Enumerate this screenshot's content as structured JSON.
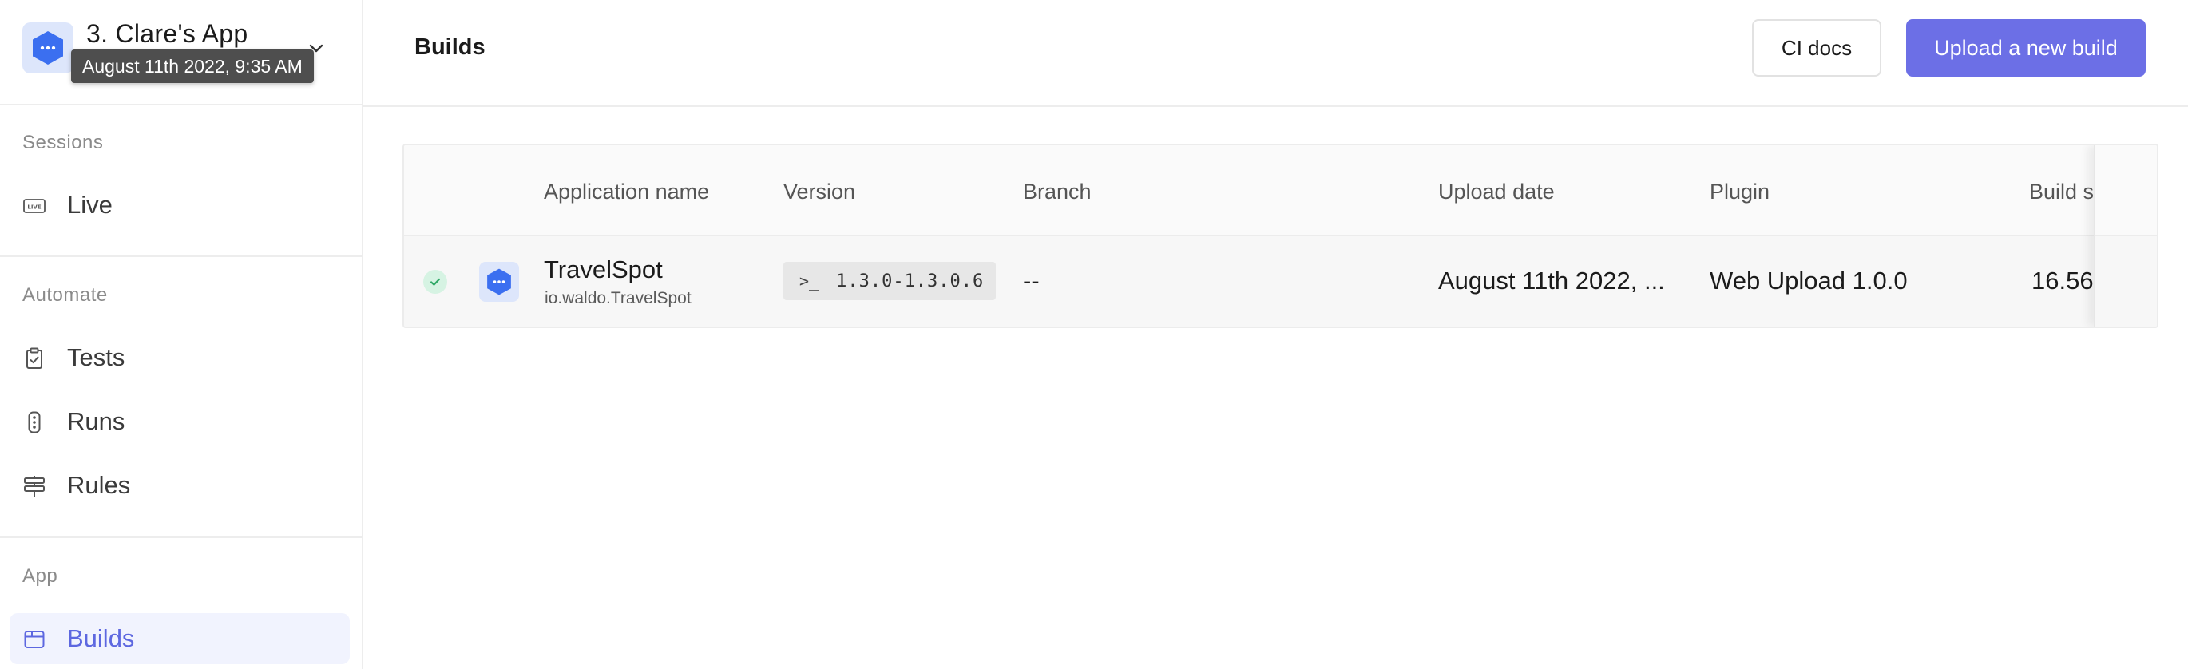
{
  "sidebar": {
    "app_name": "3. Clare's App",
    "tooltip": "August 11th 2022, 9:35 AM",
    "sections": [
      {
        "title": "Sessions",
        "items": [
          {
            "label": "Live",
            "icon": "live-icon"
          }
        ]
      },
      {
        "title": "Automate",
        "items": [
          {
            "label": "Tests",
            "icon": "clipboard-check-icon"
          },
          {
            "label": "Runs",
            "icon": "traffic-light-icon"
          },
          {
            "label": "Rules",
            "icon": "signpost-icon"
          }
        ]
      },
      {
        "title": "App",
        "items": [
          {
            "label": "Builds",
            "icon": "box-icon",
            "active": true
          }
        ]
      }
    ]
  },
  "header": {
    "title": "Builds",
    "ci_docs_label": "CI docs",
    "upload_label": "Upload a new build"
  },
  "table": {
    "columns": [
      "Application name",
      "Version",
      "Branch",
      "Upload date",
      "Plugin",
      "Build si"
    ],
    "rows": [
      {
        "status": "success",
        "app_name": "TravelSpot",
        "bundle_id": "io.waldo.TravelSpot",
        "version_prompt": ">_",
        "version": "1.3.0-1.3.0.6",
        "branch": "--",
        "upload_date": "August 11th 2022, ...",
        "plugin": "Web Upload 1.0.0",
        "build_size": "16.56"
      }
    ]
  },
  "colors": {
    "accent": "#6c6fe6",
    "active_nav_bg": "#f1f3fe",
    "active_nav_text": "#5d67e0",
    "app_logo": "#3b6ff0",
    "success": "#2fa866"
  }
}
